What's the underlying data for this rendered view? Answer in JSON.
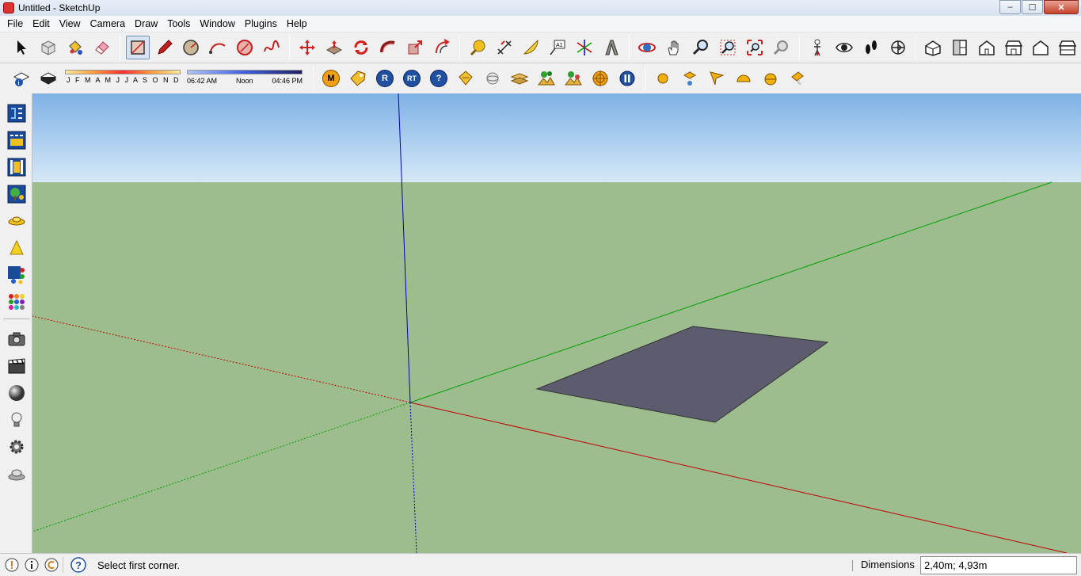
{
  "window": {
    "title": "Untitled - SketchUp",
    "controls": {
      "minimize": "–",
      "maximize": "☐",
      "close": "✕"
    }
  },
  "menu": [
    {
      "label": "File"
    },
    {
      "label": "Edit"
    },
    {
      "label": "View"
    },
    {
      "label": "Camera"
    },
    {
      "label": "Draw"
    },
    {
      "label": "Tools"
    },
    {
      "label": "Window"
    },
    {
      "label": "Plugins"
    },
    {
      "label": "Help"
    }
  ],
  "toolbar_main": [
    {
      "name": "select",
      "icon": "arrow-cursor-icon"
    },
    {
      "name": "make-component",
      "icon": "component-icon"
    },
    {
      "name": "paint-bucket",
      "icon": "paint-bucket-icon"
    },
    {
      "name": "eraser",
      "icon": "eraser-icon"
    },
    {
      "name": "rectangle",
      "icon": "rectangle-icon",
      "active": true
    },
    {
      "name": "line",
      "icon": "pencil-icon"
    },
    {
      "name": "circle",
      "icon": "circle-icon"
    },
    {
      "name": "arc",
      "icon": "arc-icon"
    },
    {
      "name": "polygon",
      "icon": "polygon-icon"
    },
    {
      "name": "freehand",
      "icon": "freehand-icon"
    },
    {
      "name": "move",
      "icon": "move-icon"
    },
    {
      "name": "push-pull",
      "icon": "push-pull-icon"
    },
    {
      "name": "rotate",
      "icon": "rotate-icon"
    },
    {
      "name": "follow-me",
      "icon": "follow-me-icon"
    },
    {
      "name": "scale",
      "icon": "scale-icon"
    },
    {
      "name": "offset",
      "icon": "offset-icon"
    },
    {
      "name": "tape-measure",
      "icon": "tape-measure-icon"
    },
    {
      "name": "dimension",
      "icon": "dimension-icon"
    },
    {
      "name": "protractor",
      "icon": "protractor-icon"
    },
    {
      "name": "text",
      "icon": "text-label-icon"
    },
    {
      "name": "axes",
      "icon": "axes-icon"
    },
    {
      "name": "3d-text",
      "icon": "3d-text-icon"
    },
    {
      "name": "orbit",
      "icon": "orbit-icon"
    },
    {
      "name": "pan",
      "icon": "pan-hand-icon"
    },
    {
      "name": "zoom",
      "icon": "zoom-icon"
    },
    {
      "name": "zoom-window",
      "icon": "zoom-window-icon"
    },
    {
      "name": "zoom-extents",
      "icon": "zoom-extents-icon"
    },
    {
      "name": "previous-view",
      "icon": "previous-view-icon"
    },
    {
      "name": "position-camera",
      "icon": "position-camera-icon"
    },
    {
      "name": "look-around",
      "icon": "eye-icon"
    },
    {
      "name": "walk",
      "icon": "footprints-icon"
    },
    {
      "name": "section-plane",
      "icon": "section-plane-icon"
    },
    {
      "name": "iso-view",
      "icon": "iso-house-icon"
    },
    {
      "name": "top-view",
      "icon": "top-view-icon"
    },
    {
      "name": "front-view",
      "icon": "front-view-icon"
    },
    {
      "name": "right-view",
      "icon": "right-view-icon"
    },
    {
      "name": "back-view",
      "icon": "back-view-icon"
    },
    {
      "name": "left-view",
      "icon": "left-view-icon"
    }
  ],
  "shadows": {
    "months": "J F M A M J J A S O N D",
    "time_start": "06:42 AM",
    "time_mid": "Noon",
    "time_end": "04:46 PM"
  },
  "toolbar_plugins": [
    {
      "name": "m",
      "label": "M",
      "icon": "m-badge-icon"
    },
    {
      "name": "tag",
      "label": "",
      "icon": "tag-icon"
    },
    {
      "name": "r",
      "label": "R",
      "icon": "r-badge-icon"
    },
    {
      "name": "rt",
      "label": "RT",
      "icon": "rt-badge-icon"
    },
    {
      "name": "help",
      "label": "?",
      "icon": "help-icon"
    },
    {
      "name": "label",
      "label": "",
      "icon": "label-icon"
    },
    {
      "name": "sphere",
      "label": "",
      "icon": "sphere-icon"
    },
    {
      "name": "planes",
      "label": "",
      "icon": "planes-icon"
    },
    {
      "name": "landscape1",
      "label": "",
      "icon": "landscape-icon"
    },
    {
      "name": "landscape2",
      "label": "",
      "icon": "landscape-icon"
    },
    {
      "name": "target",
      "label": "",
      "icon": "target-icon"
    },
    {
      "name": "pause",
      "label": "",
      "icon": "pause-icon"
    }
  ],
  "toolbar_lights": [
    {
      "name": "omni-light",
      "icon": "omni-light-icon"
    },
    {
      "name": "spot-light",
      "icon": "spot-light-icon"
    },
    {
      "name": "direction-light",
      "icon": "direction-light-icon"
    },
    {
      "name": "dome-light",
      "icon": "dome-light-icon"
    },
    {
      "name": "sphere-light",
      "icon": "sphere-light-icon"
    },
    {
      "name": "ies-light",
      "icon": "ies-light-icon"
    }
  ],
  "left_toolbar": [
    {
      "name": "vray-options",
      "icon": "vray-options-icon"
    },
    {
      "name": "vray-framebuffer",
      "icon": "framebuffer-icon"
    },
    {
      "name": "vray-render",
      "icon": "film-render-icon"
    },
    {
      "name": "vray-interactive",
      "icon": "tree-render-icon"
    },
    {
      "name": "ufo-light",
      "icon": "ufo-light-icon"
    },
    {
      "name": "cone-light",
      "icon": "cone-light-icon"
    },
    {
      "name": "material-editor",
      "icon": "material-editor-icon"
    },
    {
      "name": "color-swatches",
      "icon": "swatches-icon"
    },
    {
      "name": "camera",
      "icon": "camera-icon"
    },
    {
      "name": "animation",
      "icon": "clapperboard-icon"
    },
    {
      "name": "materials",
      "icon": "ball-icon"
    },
    {
      "name": "lights",
      "icon": "bulb-icon"
    },
    {
      "name": "settings",
      "icon": "gear-icon"
    },
    {
      "name": "environment",
      "icon": "cloud-icon"
    }
  ],
  "status": {
    "message": "Select first corner.",
    "dimensions_label": "Dimensions",
    "dimensions_value": "2,40m; 4,93m"
  },
  "colors": {
    "sky_top": "#7fb1e6",
    "sky_bottom": "#d6e8f7",
    "ground": "#9dbd8e",
    "face": "#5c5c6e",
    "axis_red": "#c00000",
    "axis_green": "#00a000",
    "axis_blue": "#0000c0"
  }
}
